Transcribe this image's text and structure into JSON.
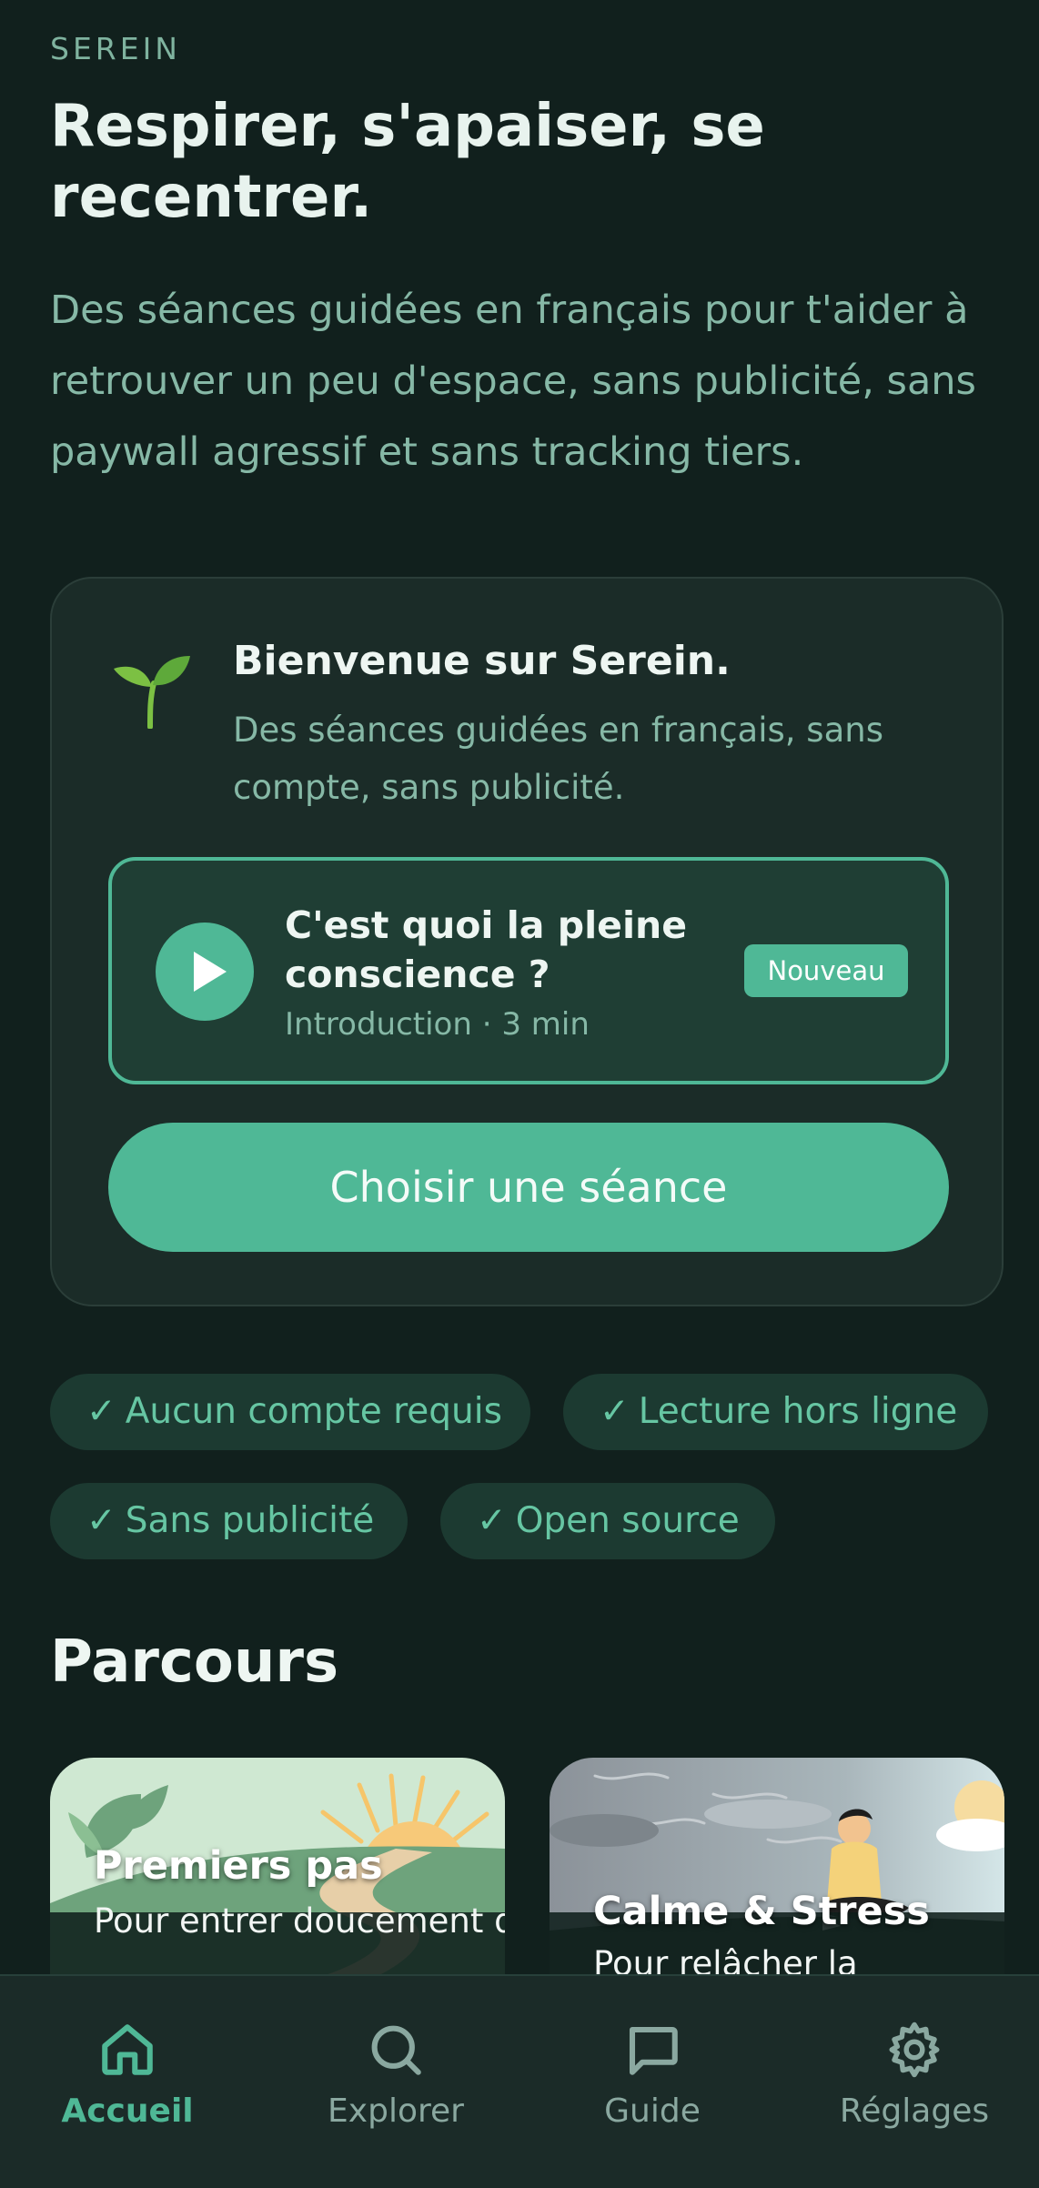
{
  "header": {
    "brand": "SEREIN",
    "headline": "Respirer, s'apaiser, se recentrer.",
    "intro": "Des séances guidées en français pour t'aider à retrouver un peu d'espace, sans publicité, sans paywall agressif et sans tracking tiers."
  },
  "welcome": {
    "icon": "sprout-icon",
    "title": "Bienvenue sur Serein.",
    "description": "Des séances guidées en français, sans compte, sans publicité.",
    "session": {
      "title": "C'est quoi la pleine conscience ?",
      "meta": "Introduction · 3 min",
      "badge": "Nouveau"
    },
    "cta": "Choisir une séance"
  },
  "features": [
    {
      "check": "✓",
      "label": "Aucun compte requis"
    },
    {
      "check": "✓",
      "label": "Lecture hors ligne"
    },
    {
      "check": "✓",
      "label": "Sans publicité"
    },
    {
      "check": "✓",
      "label": "Open source"
    }
  ],
  "courses": {
    "title": "Parcours",
    "items": [
      {
        "title": "Premiers pas",
        "description": "Pour entrer doucement dans la"
      },
      {
        "title": "Calme & Stress",
        "description": "Pour relâcher la"
      }
    ]
  },
  "nav": {
    "items": [
      {
        "label": "Accueil",
        "icon": "home-icon",
        "active": true
      },
      {
        "label": "Explorer",
        "icon": "search-icon",
        "active": false
      },
      {
        "label": "Guide",
        "icon": "chat-icon",
        "active": false
      },
      {
        "label": "Réglages",
        "icon": "gear-icon",
        "active": false
      }
    ]
  },
  "colors": {
    "background": "#11201d",
    "accent": "#4fb896",
    "card": "#1b2c28",
    "muted_text": "#86b8a6"
  }
}
